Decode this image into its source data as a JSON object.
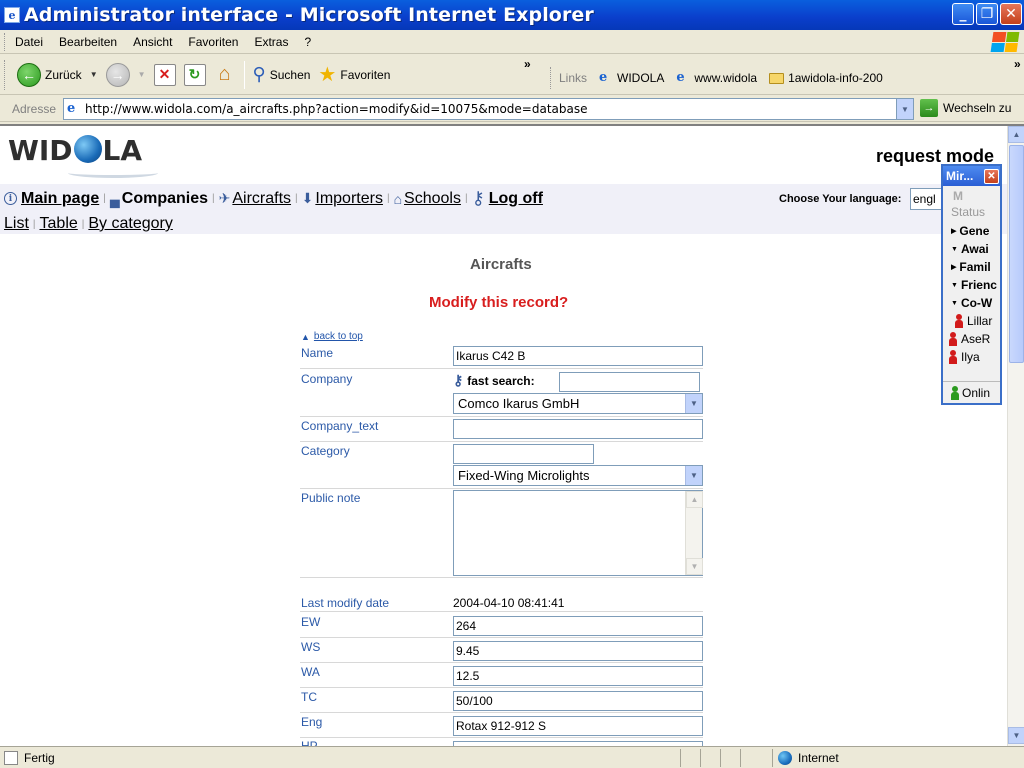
{
  "window": {
    "title": "Administrator interface - Microsoft Internet Explorer",
    "icon": "ie-page-icon",
    "buttons": [
      "_",
      "❐",
      "✕"
    ]
  },
  "menu": [
    "Datei",
    "Bearbeiten",
    "Ansicht",
    "Favoriten",
    "Extras",
    "?"
  ],
  "toolbar": {
    "back_label": "Zurück",
    "search_label": "Suchen",
    "favorites_label": "Favoriten",
    "more": "»",
    "links_label": "Links",
    "links": [
      "WIDOLA",
      "www.widola",
      "1awidola-info-200"
    ]
  },
  "address": {
    "label": "Adresse",
    "url": "http://www.widola.com/a_aircrafts.php?action=modify&id=10075&mode=database",
    "go_label": "Wechseln zu"
  },
  "page": {
    "logo": {
      "left": "WID",
      "right": "LA"
    },
    "request_mode": "request mode",
    "nav": {
      "main_page": "Main page",
      "companies": "Companies",
      "aircrafts": "Aircrafts",
      "importers": "Importers",
      "schools": "Schools",
      "log_off": "Log off"
    },
    "subnav": [
      "List",
      "Table",
      "By category"
    ],
    "choose_language": "Choose Your language:",
    "language_value": "engl",
    "section_title": "Aircrafts",
    "modify_question": "Modify this record?",
    "back_to_top": "back to top",
    "form": {
      "name_label": "Name",
      "name_value": "Ikarus C42 B",
      "company_label": "Company",
      "fast_search_label": "fast search:",
      "company_value": "Comco Ikarus GmbH",
      "company_text_label": "Company_text",
      "category_label": "Category",
      "category_value": "Fixed-Wing Microlights",
      "public_note_label": "Public note",
      "last_modify_label": "Last modify date",
      "last_modify_value": "2004-04-10 08:41:41",
      "ew_label": "EW",
      "ew_value": "264",
      "ws_label": "WS",
      "ws_value": "9.45",
      "wa_label": "WA",
      "wa_value": "12.5",
      "tc_label": "TC",
      "tc_value": "50/100",
      "eng_label": "Eng",
      "eng_value": "Rotax 912-912 S",
      "hp_label": "HP"
    }
  },
  "messenger": {
    "title": "Mir...",
    "status": "Status",
    "groups": [
      "Gene",
      "Awai",
      "Famil",
      "Frienc",
      "Co-W"
    ],
    "contacts": [
      "Lillar",
      "AseR",
      "Ilya"
    ],
    "online": "Onlin"
  },
  "status": {
    "text": "Fertig",
    "zone": "Internet"
  }
}
